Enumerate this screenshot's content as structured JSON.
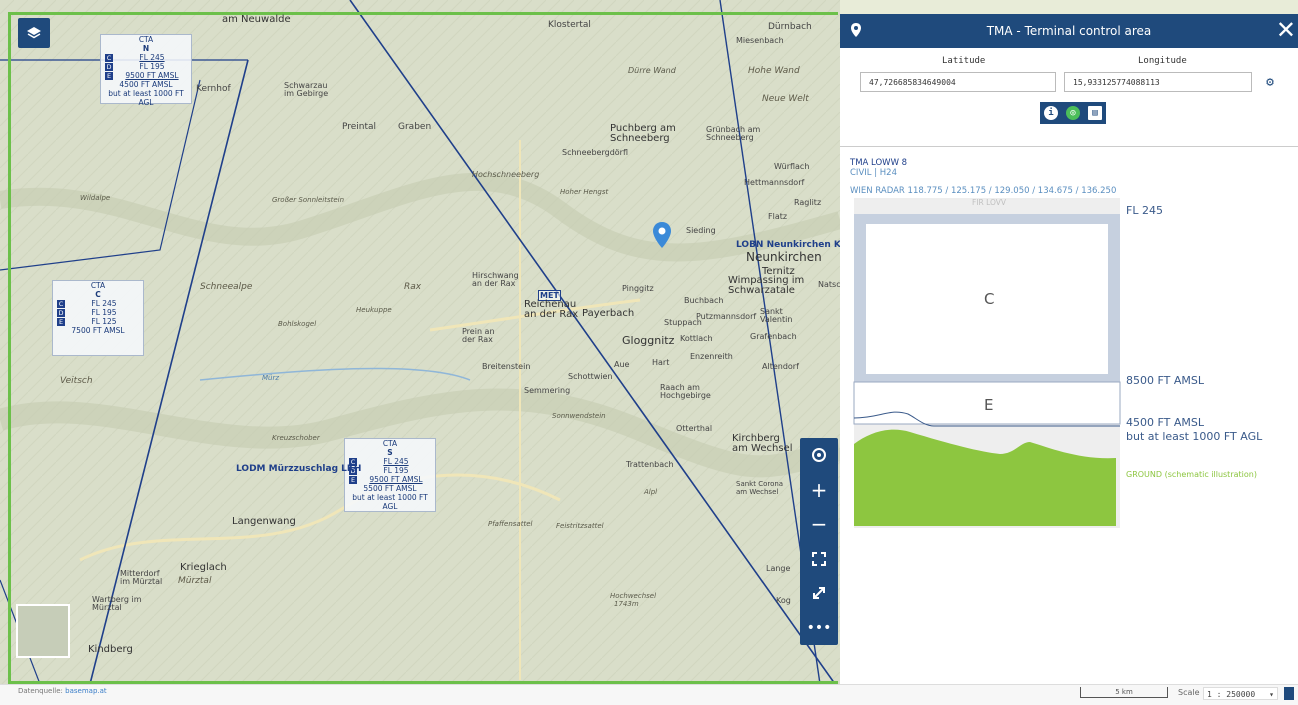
{
  "map": {
    "cta_boxes": [
      {
        "head": "CTA",
        "dir": "N",
        "classes": [
          "C",
          "D",
          "E"
        ],
        "lines": [
          "FL 245",
          "FL 195",
          "9500 FT AMSL",
          "4500 FT AMSL",
          "but at least 1000 FT AGL"
        ]
      },
      {
        "head": "CTA",
        "dir": "C",
        "classes": [
          "C",
          "D",
          "E"
        ],
        "lines": [
          "FL 245",
          "FL 195",
          "FL 125",
          "7500 FT AMSL"
        ]
      },
      {
        "head": "CTA",
        "dir": "S",
        "classes": [
          "C",
          "D",
          "E"
        ],
        "lines": [
          "FL 245",
          "FL 195",
          "9500 FT AMSL",
          "5500 FT AMSL",
          "but at least 1000 FT AGL"
        ]
      }
    ],
    "labels": {
      "am_neuwalde": "am Neuwalde",
      "klostertal": "Klostertal",
      "durrbach": "Dürnbach",
      "miesenbach": "Miesenbach",
      "durre_wand": "Dürre Wand",
      "hohe_wand": "Hohe Wand",
      "neue_welt": "Neue Welt",
      "kernhof": "Kernhof",
      "schwarzau": "Schwarzau im Gebirge",
      "prein": "Preintal",
      "graben": "Graben",
      "puchberg": "Puchberg am Schneeberg",
      "schneebergdorfl": "Schneebergdörfl",
      "grunbach": "Grünbach am Schneeberg",
      "hochschneeberg": "Hochschneeberg",
      "wurflach": "Würflach",
      "hettmannsdorf": "Hettmannsdorf",
      "raglitz": "Raglitz",
      "flatz": "Flatz",
      "sieding": "Sieding",
      "hoher_hengst": "Hoher Hengst",
      "groser_sonnleitstein": "Großer Sonnleitstein",
      "wildalpe": "Wildalpe",
      "lobn": "LOBN Neunkirchen KH",
      "neunkirchen": "Neunkirchen",
      "ternitz": "Ternitz",
      "wimpassing": "Wimpassing im Schwarzatale",
      "natschbach": "Natschb",
      "schneealpe": "Schneealpe",
      "rax": "Rax",
      "hirschwang": "Hirschwang an der Rax",
      "reichenau": "Reichenau an der Rax",
      "payerbach": "Payerbach",
      "pinggitz": "Pinggitz",
      "buchbach": "Buchbach",
      "putzmannsdorf": "Putzmannsdorf",
      "sankt_valentin": "Sankt Valentin",
      "stuppach": "Stuppach",
      "gloggnitz": "Gloggnitz",
      "kottlach": "Kottlach",
      "grafenbach": "Grafenbach",
      "enzenreith": "Enzenreith",
      "prein_rax": "Prein an der Rax",
      "breitenstein": "Breitenstein",
      "schottwien": "Schottwien",
      "aue": "Aue",
      "hart": "Hart",
      "altendorf": "Altendorf",
      "heukuppe": "Heukuppe",
      "bohlskogel": "Bohlskogel",
      "veitsch": "Veitsch",
      "semmering": "Semmering",
      "sonnwendstein": "Sonnwendstein",
      "raach": "Raach am Hochgebirge",
      "otterthal": "Otterthal",
      "kirchberg": "Kirchberg am Wechsel",
      "trattenbach": "Trattenbach",
      "sankt_corona": "Sankt Corona am Wechsel",
      "kreuzschober": "Kreuzschober",
      "lodm": "LODM Mürzzuschlag LKH",
      "langenwang": "Langenwang",
      "krieglach": "Krieglach",
      "mitterdorf": "Mitterdorf im Mürztal",
      "murztal": "Mürztal",
      "wartberg": "Wartberg im Mürztal",
      "kindberg": "Kindberg",
      "alpl": "Alpl",
      "hochwechsel": "Hochwechsel",
      "pfaffensattel": "Pfaffensattel",
      "feistritzsattel": "Feistritzsattel",
      "lange": "Lange",
      "koglhof": "Kog",
      "murz": "Mürz",
      "met": "MET",
      "hochwechsel_alt": "1743m"
    }
  },
  "panel": {
    "title": "TMA - Terminal control area",
    "lat_label": "Latitude",
    "lon_label": "Longitude",
    "lat_value": "47,726685834649004",
    "lon_value": "15,933125774088113",
    "area_name": "TMA LOWW 8",
    "area_type": "CIVIL | H24",
    "frequencies": "WIEN RADAR  118.775 / 125.175 / 129.050 / 134.675 / 136.250",
    "fir": "FIR LOVV",
    "upper": "FL 245",
    "class_upper": "C",
    "mid": "8500 FT AMSL",
    "class_lower": "E",
    "lower1": "4500 FT AMSL",
    "lower2": "but at least 1000 FT AGL",
    "ground": "GROUND (schematic illustration)",
    "close": "✕"
  },
  "footer": {
    "source_prefix": "Datenquelle:",
    "source_link": "basemap.at",
    "scale_bar": "5 km",
    "scale_label": "Scale",
    "scale_value": "1 : 250000"
  },
  "colors": {
    "accent": "#1f4a7c",
    "frame": "#6cc04a",
    "ground": "#8dc640",
    "airspace": "#1f3f8a"
  }
}
